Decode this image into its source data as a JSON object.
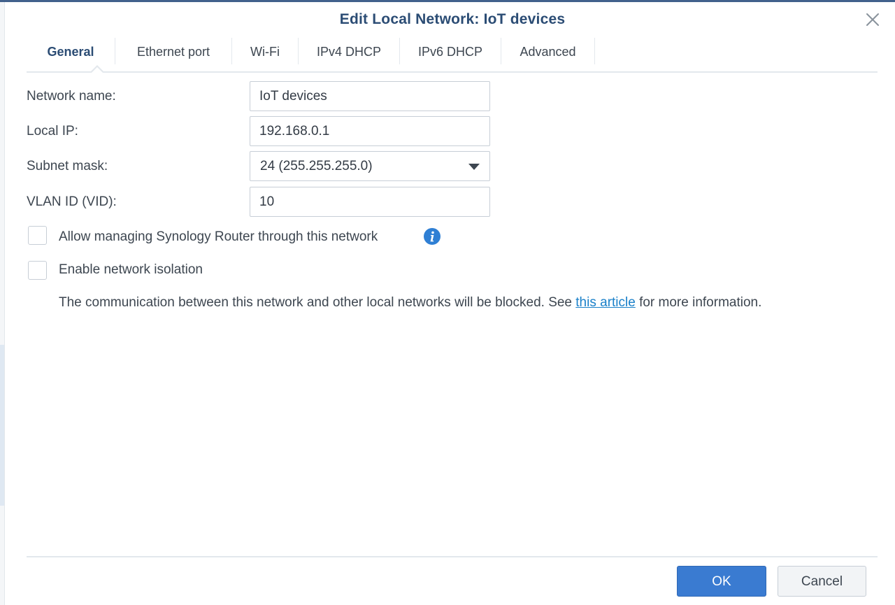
{
  "dialog": {
    "title": "Edit Local Network: IoT devices"
  },
  "tabs": [
    {
      "label": "General",
      "active": true
    },
    {
      "label": "Ethernet port",
      "active": false
    },
    {
      "label": "Wi-Fi",
      "active": false
    },
    {
      "label": "IPv4 DHCP",
      "active": false
    },
    {
      "label": "IPv6 DHCP",
      "active": false
    },
    {
      "label": "Advanced",
      "active": false
    }
  ],
  "form": {
    "network_name": {
      "label": "Network name:",
      "value": "IoT devices"
    },
    "local_ip": {
      "label": "Local IP:",
      "value": "192.168.0.1"
    },
    "subnet_mask": {
      "label": "Subnet mask:",
      "value": "24 (255.255.255.0)"
    },
    "vlan_id": {
      "label": "VLAN ID (VID):",
      "value": "10"
    },
    "allow_managing": {
      "label": "Allow managing Synology Router through this network",
      "checked": false
    },
    "network_isolation": {
      "label": "Enable network isolation",
      "checked": false
    },
    "help": {
      "before": "The communication between this network and other local networks will be blocked. See ",
      "link": "this article",
      "after": " for more information."
    }
  },
  "footer": {
    "ok_label": "OK",
    "cancel_label": "Cancel"
  },
  "colors": {
    "title": "#2b4c74",
    "primary_button": "#3a7bd1",
    "link": "#1a80c9",
    "info_icon": "#2f7fd4"
  },
  "icons": {
    "close": "close-icon",
    "info": "info-icon",
    "dropdown": "chevron-down-icon"
  }
}
